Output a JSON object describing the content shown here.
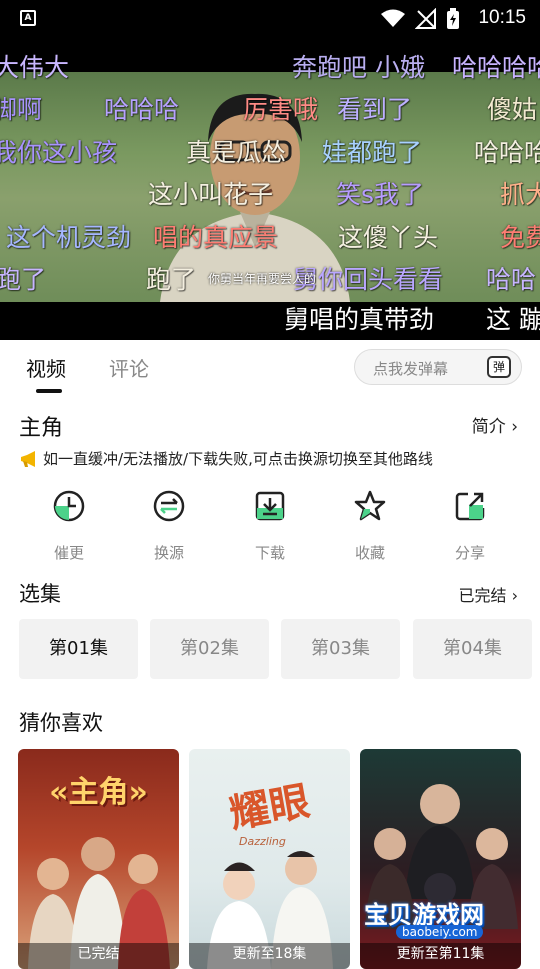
{
  "status_bar": {
    "time": "10:15",
    "icon_a": "A"
  },
  "player": {
    "subtitle": "你舅当年再要尝人的",
    "danmaku": [
      {
        "text": "大伟大",
        "color": "#c9b7ff"
      },
      {
        "text": "奔跑吧 小娥",
        "color": "#b9aef0"
      },
      {
        "text": "哈哈哈哈",
        "color": "#c8b3ff"
      },
      {
        "text": "脚啊",
        "color": "#a993ff"
      },
      {
        "text": "哈哈哈",
        "color": "#b6a2ff"
      },
      {
        "text": "厉害哦",
        "color": "#ff8b86"
      },
      {
        "text": "看到了",
        "color": "#bdb0ff"
      },
      {
        "text": "傻姑",
        "color": "#f1e8cf"
      },
      {
        "text": "我你这小孩",
        "color": "#a892ff"
      },
      {
        "text": "真是瓜怂",
        "color": "#f4efe0"
      },
      {
        "text": "娃都跑了",
        "color": "#a8d1ff"
      },
      {
        "text": "哈哈哈",
        "color": "#f4efe0"
      },
      {
        "text": "这小叫花子",
        "color": "#f4efe0"
      },
      {
        "text": "笑s我了",
        "color": "#b79cff"
      },
      {
        "text": "抓大",
        "color": "#ffb08a"
      },
      {
        "text": "这个机灵劲",
        "color": "#a5b6ff"
      },
      {
        "text": "唱的真应景",
        "color": "#ff7d73"
      },
      {
        "text": "这傻丫头",
        "color": "#f4efe0"
      },
      {
        "text": "免费",
        "color": "#ff7d73"
      },
      {
        "text": "跑了",
        "color": "#c7b5ff"
      },
      {
        "text": "跑了",
        "color": "#f4efe0"
      },
      {
        "text": "舅你回头看看",
        "color": "#b9a6ff"
      },
      {
        "text": "哈哈",
        "color": "#c7b5ff"
      },
      {
        "text": "舅唱的真带劲",
        "color": "#ffffff"
      },
      {
        "text": "这 蹦",
        "color": "#ffffff"
      }
    ]
  },
  "tabs": [
    {
      "label": "视频"
    },
    {
      "label": "评论"
    }
  ],
  "danmu_input": {
    "placeholder": "点我发弹幕",
    "send_label": "弹"
  },
  "show": {
    "title": "主角",
    "intro_label": "简介 ›"
  },
  "notice": "如一直缓冲/无法播放/下载失败,可点击换源切换至其他路线",
  "actions": [
    {
      "label": "催更",
      "icon": "clock-icon"
    },
    {
      "label": "换源",
      "icon": "switch-source-icon"
    },
    {
      "label": "下载",
      "icon": "download-icon"
    },
    {
      "label": "收藏",
      "icon": "star-icon"
    },
    {
      "label": "分享",
      "icon": "share-icon"
    }
  ],
  "episodes": {
    "title": "选集",
    "status": "已完结 ›",
    "items": [
      {
        "label": "第01集"
      },
      {
        "label": "第02集"
      },
      {
        "label": "第03集"
      },
      {
        "label": "第04集"
      }
    ]
  },
  "recommend": {
    "title": "猜你喜欢",
    "items": [
      {
        "poster_text": "«主角»",
        "caption": "已完结"
      },
      {
        "poster_text": "耀眼",
        "poster_sub": "Dazzling",
        "caption": "更新至18集"
      },
      {
        "poster_text": "宝贝游戏网",
        "poster_sub": "baobeiy.com",
        "caption": "更新至第11集"
      }
    ]
  },
  "colors": {
    "accent": "#111111",
    "muted": "#888888",
    "chip_bg": "#f2f2f2",
    "icon_green": "#4cd28a"
  }
}
